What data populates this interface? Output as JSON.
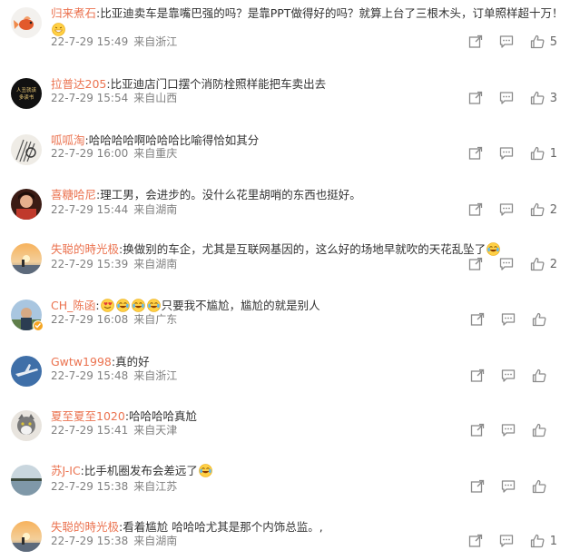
{
  "comments": [
    {
      "user": "归来煮石",
      "text": "比亚迪卖车是靠嘴巴强的吗？是靠PPT做得好的吗？就算上台了三根木头，订单照样超十万！",
      "date": "22-7-29 15:49",
      "location": "来自浙江",
      "likes": "5",
      "avatar": "goldfish",
      "text_emoji": "grin",
      "second_line": true
    },
    {
      "user": "拉普达205",
      "text": "比亚迪店门口摆个消防栓照样能把车卖出去",
      "date": "22-7-29 15:54",
      "location": "来自山西",
      "likes": "3",
      "avatar": "book-black"
    },
    {
      "user": "呱呱淘",
      "text": "哈哈哈哈啊哈哈哈比喻得恰如其分",
      "date": "22-7-29 16:00",
      "location": "来自重庆",
      "likes": "1",
      "avatar": "sketch"
    },
    {
      "user": "喜糖哈尼",
      "text": "理工男，会进步的。没什么花里胡哨的东西也挺好。",
      "date": "22-7-29 15:44",
      "location": "来自湖南",
      "likes": "2",
      "avatar": "portrait-red"
    },
    {
      "user": "失聪的時光极",
      "text": "换做别的车企，尤其是互联网基因的，这么好的场地早就吹的天花乱坠了",
      "date": "22-7-29 15:39",
      "location": "来自湖南",
      "likes": "2",
      "avatar": "sunset",
      "text_emoji": "laugh-cry"
    },
    {
      "user": "CH_陈函",
      "text": "只要我不尴尬，尴尬的就是别人",
      "date": "22-7-29 16:08",
      "location": "来自广东",
      "likes": "",
      "avatar": "outdoor",
      "verified": true,
      "lead_emojis": [
        "smile-heart",
        "laugh-cry",
        "laugh-cry",
        "laugh-cry"
      ]
    },
    {
      "user": "Gwtw1998",
      "text": "真的好",
      "date": "22-7-29 15:48",
      "location": "来自浙江",
      "likes": "",
      "avatar": "plane"
    },
    {
      "user": "夏至夏至1020",
      "text": "哈哈哈哈真尬",
      "date": "22-7-29 15:41",
      "location": "来自天津",
      "likes": "",
      "avatar": "cat"
    },
    {
      "user": "苏J-IC",
      "text": "比手机圈发布会差远了",
      "date": "22-7-29 15:38",
      "location": "来自江苏",
      "likes": "",
      "avatar": "lake",
      "text_emoji": "laugh-cry"
    },
    {
      "user": "失聪的時光极",
      "text": "看着尴尬 哈哈哈尤其是那个内饰总监。,",
      "date": "22-7-29 15:38",
      "location": "来自湖南",
      "likes": "1",
      "avatar": "sunset"
    }
  ],
  "icons": {
    "forward": "share-icon",
    "reply": "comment-icon",
    "like": "thumbs-up-icon"
  },
  "colors": {
    "username": "#eb7350",
    "meta": "#808080",
    "text": "#333333",
    "icon": "#8a8a8a"
  }
}
